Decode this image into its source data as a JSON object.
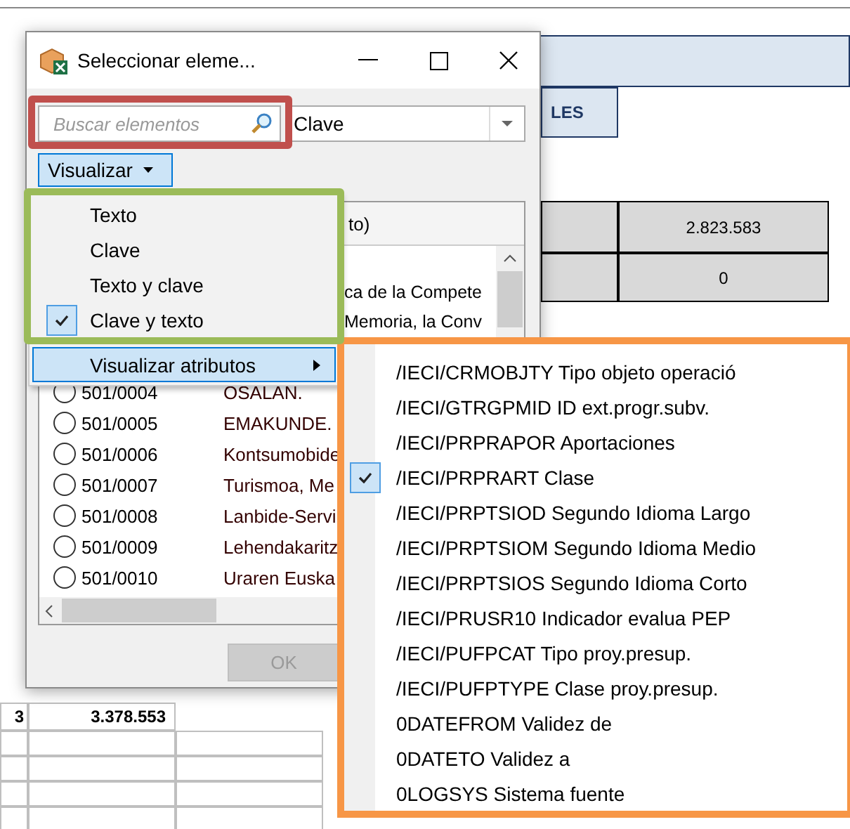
{
  "window": {
    "title": "Seleccionar eleme..."
  },
  "search": {
    "placeholder": "Buscar elementos"
  },
  "display_select": {
    "value": "Clave"
  },
  "visualizar_button": {
    "label": "Visualizar"
  },
  "list": {
    "header": "to)",
    "partial_rows": [
      "ca de la Compete",
      "Memoria, la Conv"
    ],
    "rows": [
      {
        "key": "501/0004",
        "text": "OSALAN.",
        "selected": false
      },
      {
        "key": "501/0005",
        "text": "EMAKUNDE.",
        "selected": false
      },
      {
        "key": "501/0006",
        "text": "Kontsumobide",
        "selected": false
      },
      {
        "key": "501/0007",
        "text": "Turismoa, Me",
        "selected": false
      },
      {
        "key": "501/0008",
        "text": "Lanbide-Servi",
        "selected": false
      },
      {
        "key": "501/0009",
        "text": "Lehendakaritz",
        "selected": false
      },
      {
        "key": "501/0010",
        "text": "Uraren Euska",
        "selected": false
      }
    ]
  },
  "ok_button": {
    "label": "OK",
    "disabled": true
  },
  "menu": {
    "items": [
      {
        "label": "Texto",
        "checked": false
      },
      {
        "label": "Clave",
        "checked": false
      },
      {
        "label": "Texto y clave",
        "checked": false
      },
      {
        "label": "Clave y texto",
        "checked": true
      }
    ],
    "submenu_item": {
      "label": "Visualizar atributos",
      "highlighted": true
    }
  },
  "submenu": {
    "items": [
      {
        "label": "/IECI/CRMOBJTY Tipo objeto operació",
        "checked": false
      },
      {
        "label": "/IECI/GTRGPMID ID ext.progr.subv.",
        "checked": false
      },
      {
        "label": "/IECI/PRPRAPOR Aportaciones",
        "checked": false
      },
      {
        "label": "/IECI/PRPRART Clase",
        "checked": true
      },
      {
        "label": "/IECI/PRPTSIOD Segundo Idioma Largo",
        "checked": false
      },
      {
        "label": "/IECI/PRPTSIOM Segundo Idioma Medio",
        "checked": false
      },
      {
        "label": "/IECI/PRPTSIOS Segundo Idioma Corto",
        "checked": false
      },
      {
        "label": "/IECI/PRUSR10 Indicador evalua PEP",
        "checked": false
      },
      {
        "label": "/IECI/PUFPCAT Tipo proy.presup.",
        "checked": false
      },
      {
        "label": "/IECI/PUFPTYPE Clase proy.presup.",
        "checked": false
      },
      {
        "label": "0DATEFROM Validez de",
        "checked": false
      },
      {
        "label": "0DATETO Validez a",
        "checked": false
      },
      {
        "label": "0LOGSYS Sistema fuente",
        "checked": false
      }
    ]
  },
  "sheet": {
    "header_cell": "LES",
    "values": [
      "2.823.583",
      "0"
    ],
    "footer_cells": [
      "3",
      "3.378.553"
    ]
  }
}
